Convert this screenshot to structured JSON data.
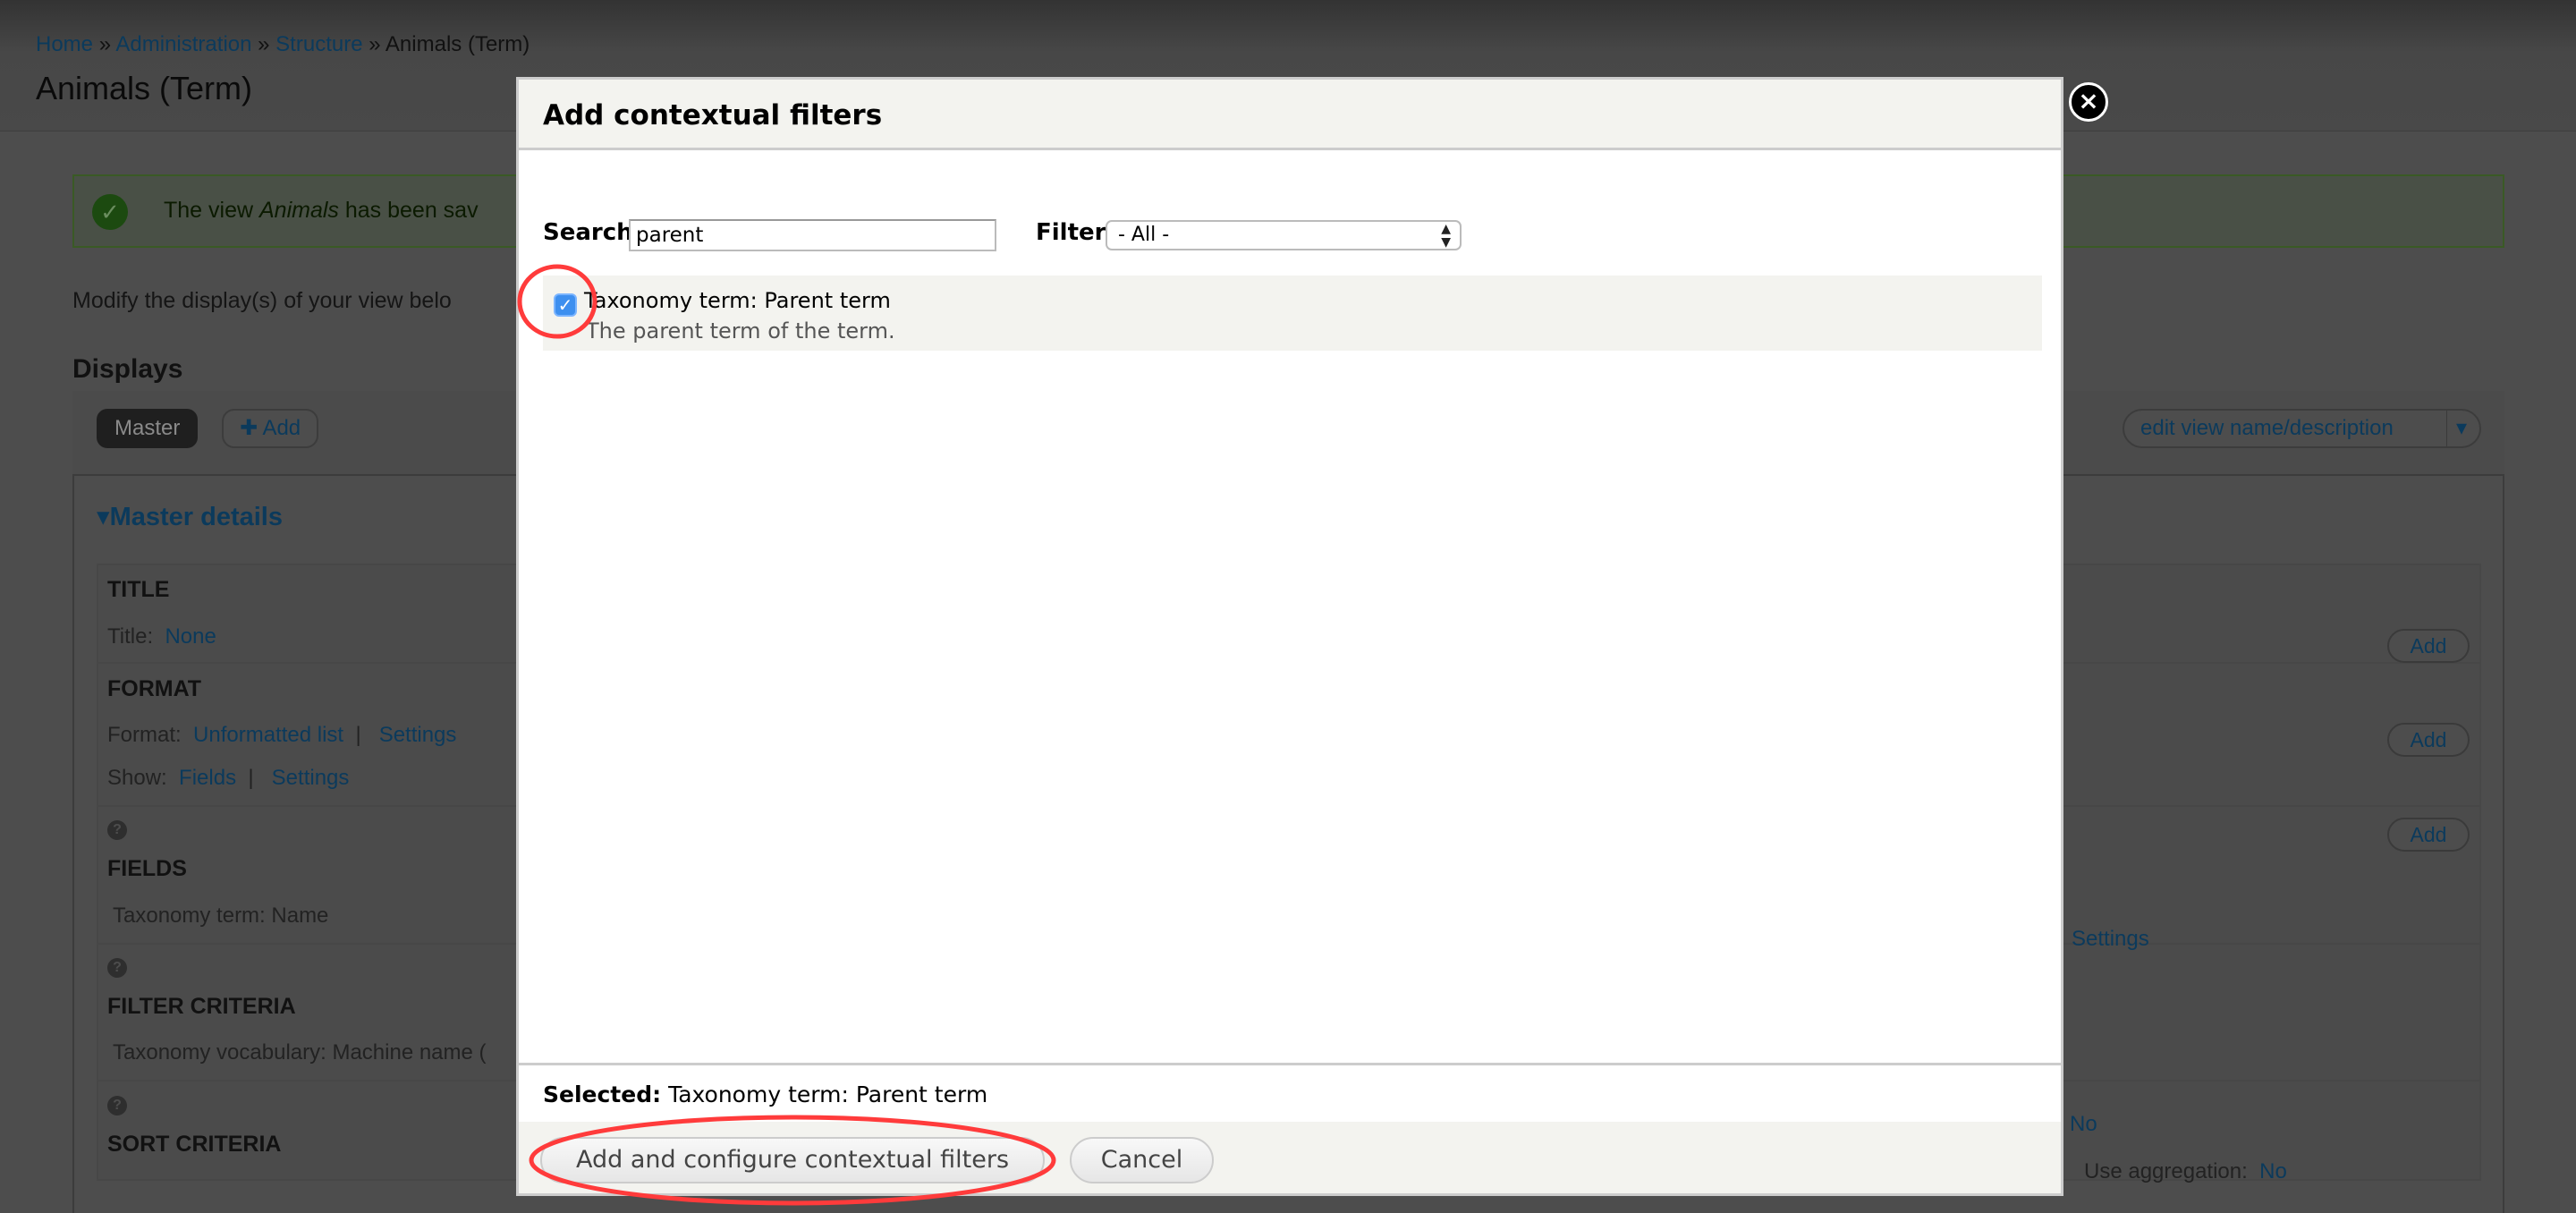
{
  "breadcrumb": {
    "items": [
      "Home",
      "Administration",
      "Structure"
    ],
    "current": "Animals (Term)",
    "separator": "»"
  },
  "page": {
    "title": "Animals (Term)"
  },
  "message": {
    "prefix": "The view ",
    "view_name": "Animals",
    "suffix": " has been sav"
  },
  "modify_text": "Modify the display(s) of your view belo",
  "displays": {
    "heading": "Displays",
    "master": "Master",
    "add": "Add",
    "add_icon": "plus-icon",
    "edit_view": "edit view name/description"
  },
  "master_details": {
    "label": "Master details",
    "title_section": {
      "heading": "TITLE",
      "label": "Title:",
      "value": "None"
    },
    "format_section": {
      "heading": "FORMAT",
      "format_label": "Format:",
      "format_value": "Unformatted list",
      "settings": "Settings",
      "show_label": "Show:",
      "show_value": "Fields",
      "separator": "|"
    },
    "fields_section": {
      "heading": "FIELDS",
      "item": "Taxonomy term: Name"
    },
    "filter_section": {
      "heading": "FILTER CRITERIA",
      "item": "Taxonomy vocabulary: Machine name ("
    },
    "sort_section": {
      "heading": "SORT CRITERIA"
    },
    "help_icon": "?",
    "right": {
      "add": "Add",
      "settings": "Settings",
      "no": "No",
      "use_aggregation_label": "Use aggregation:",
      "use_aggregation_value": "No"
    }
  },
  "dialog": {
    "title": "Add contextual filters",
    "close_icon": "×",
    "search_label": "Search",
    "search_value": "parent",
    "filter_label": "Filter",
    "filter_value": "- All -",
    "results": [
      {
        "title": "Taxonomy term: Parent term",
        "description": "The parent term of the term.",
        "checked": true
      }
    ],
    "selected_label": "Selected:",
    "selected_value": "Taxonomy term: Parent term",
    "primary_button": "Add and configure contextual filters",
    "cancel_button": "Cancel"
  },
  "colors": {
    "link": "#0074bd",
    "annotation": "#ff3b3b",
    "checkbox": "#3d8fef",
    "success": "#3b8b1f"
  }
}
